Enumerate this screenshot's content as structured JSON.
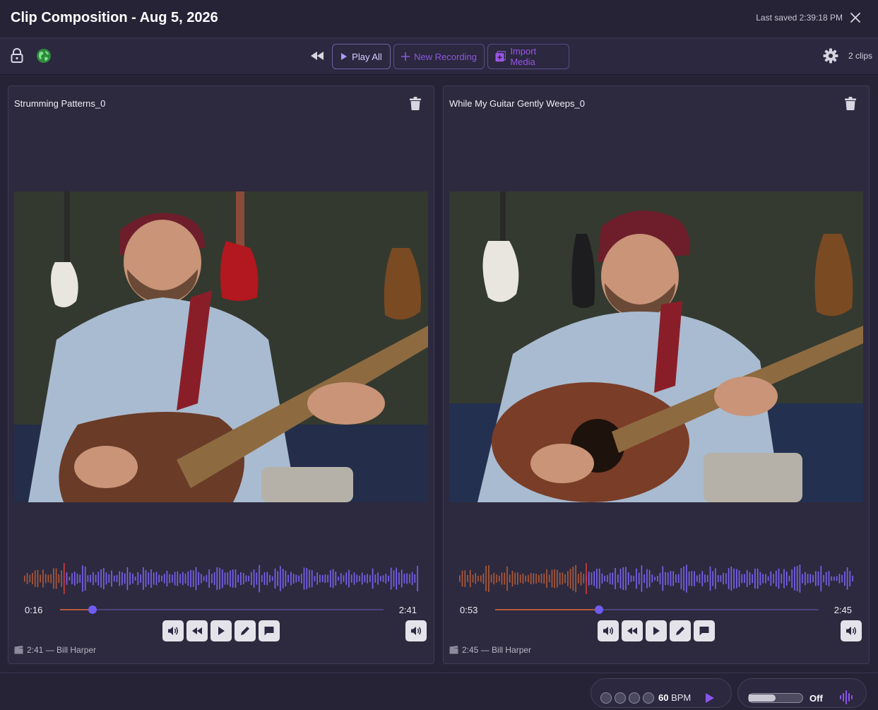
{
  "header": {
    "title": "Clip Composition - Aug 5, 2026",
    "last_saved": "Last saved 2:39:18 PM"
  },
  "toolbar": {
    "play_all_label": "Play All",
    "new_recording_label": "New Recording",
    "import_media_label": "Import Media",
    "clip_count": "2 clips"
  },
  "colors": {
    "accent": "#6f5cf1",
    "waveform_played": "#b05a3a",
    "waveform_unplayed": "#7b63f3",
    "playhead": "#e23a3a",
    "background": "#262336"
  },
  "clips": [
    {
      "title": "Strumming Patterns_0",
      "current_time": "0:16",
      "duration": "2:41",
      "progress": 0.1,
      "meta": "2:41 — Bill Harper"
    },
    {
      "title": "While My Guitar Gently Weeps_0",
      "current_time": "0:53",
      "duration": "2:45",
      "progress": 0.32,
      "meta": "2:45 — Bill Harper"
    }
  ],
  "footer": {
    "bpm_value": "60",
    "bpm_unit": "BPM",
    "monitor_state": "Off",
    "monitor_level": 0.5
  }
}
